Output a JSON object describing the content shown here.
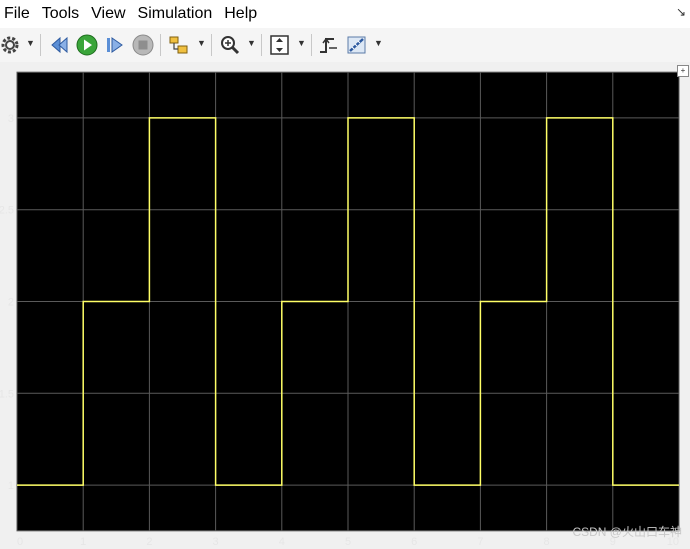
{
  "menu": {
    "items": [
      "File",
      "Tools",
      "View",
      "Simulation",
      "Help"
    ],
    "corner_icon": "undock-arrow-icon"
  },
  "toolbar": {
    "buttons": [
      {
        "name": "settings",
        "icon": "gear-icon",
        "dropdown": true
      },
      {
        "name": "step-back",
        "icon": "step-back-icon"
      },
      {
        "name": "run",
        "icon": "play-icon",
        "color": "#3aa53a"
      },
      {
        "name": "step-forward",
        "icon": "step-forward-icon"
      },
      {
        "name": "stop",
        "icon": "stop-icon",
        "color": "#9a9a9a"
      },
      {
        "name": "highlight",
        "icon": "highlight-block-icon",
        "dropdown": true
      },
      {
        "name": "zoom",
        "icon": "zoom-in-icon",
        "dropdown": true
      },
      {
        "name": "autoscale",
        "icon": "autoscale-icon",
        "dropdown": true
      },
      {
        "name": "triggers",
        "icon": "trigger-icon"
      },
      {
        "name": "measure",
        "icon": "cursor-measure-icon",
        "dropdown": true
      }
    ]
  },
  "scope": {
    "background": "#000000",
    "grid_color": "#5a5a5a",
    "line_color": "#ffff66",
    "watermark": "CSDN @火山口车神"
  },
  "chart_data": {
    "type": "line",
    "step": true,
    "xlim": [
      0,
      10
    ],
    "ylim": [
      0.75,
      3.25
    ],
    "x_ticks": [
      "0",
      "1",
      "2",
      "3",
      "4",
      "5",
      "6",
      "7",
      "8",
      "9",
      "10"
    ],
    "y_ticks": [
      "1",
      "1.5",
      "2",
      "2.5",
      "3"
    ],
    "y_tick_values": [
      1,
      1.5,
      2,
      2.5,
      3
    ],
    "grid": true,
    "series": [
      {
        "x": [
          0,
          1,
          1,
          2,
          2,
          3,
          3,
          4,
          4,
          5,
          5,
          6,
          6,
          7,
          7,
          8,
          8,
          9,
          9,
          10
        ],
        "y": [
          1,
          1,
          2,
          2,
          3,
          3,
          1,
          1,
          2,
          2,
          3,
          3,
          1,
          1,
          2,
          2,
          3,
          3,
          1,
          1
        ]
      }
    ]
  }
}
